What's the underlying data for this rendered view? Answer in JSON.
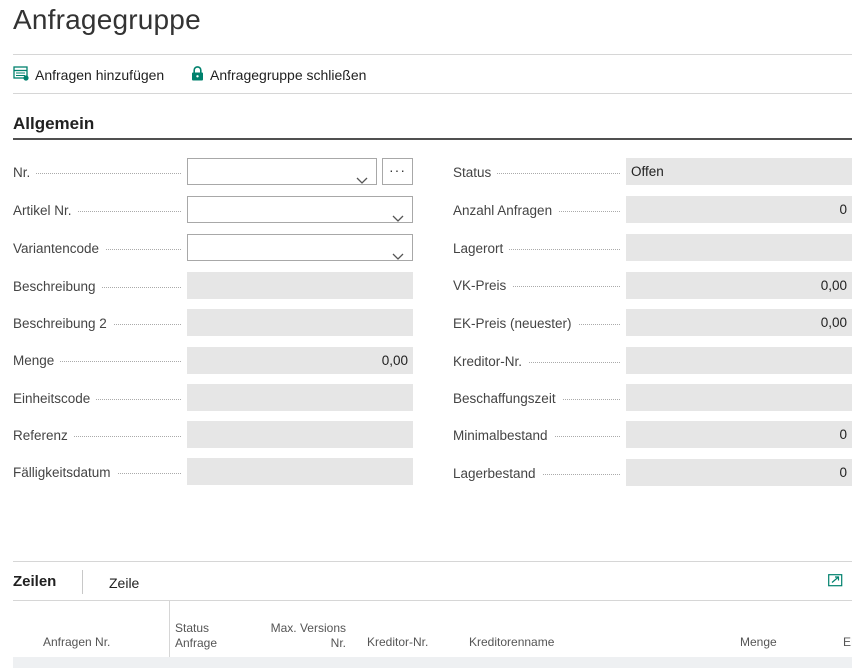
{
  "page": {
    "title": "Anfragegruppe"
  },
  "actions": {
    "add_requests": "Anfragen hinzufügen",
    "close_group": "Anfragegruppe schließen"
  },
  "general": {
    "section_title": "Allgemein",
    "nr": {
      "label": "Nr.",
      "value": ""
    },
    "artikel_nr": {
      "label": "Artikel Nr.",
      "value": ""
    },
    "variantencode": {
      "label": "Variantencode",
      "value": ""
    },
    "beschreibung": {
      "label": "Beschreibung",
      "value": ""
    },
    "beschreibung2": {
      "label": "Beschreibung 2",
      "value": ""
    },
    "menge": {
      "label": "Menge",
      "value": "0,00"
    },
    "einheitscode": {
      "label": "Einheitscode",
      "value": ""
    },
    "referenz": {
      "label": "Referenz",
      "value": ""
    },
    "faelligkeitsdatum": {
      "label": "Fälligkeitsdatum",
      "value": ""
    },
    "status": {
      "label": "Status",
      "value": "Offen"
    },
    "anzahl_anfragen": {
      "label": "Anzahl Anfragen",
      "value": "0"
    },
    "lagerort": {
      "label": "Lagerort",
      "value": ""
    },
    "vk_preis": {
      "label": "VK-Preis",
      "value": "0,00"
    },
    "ek_preis": {
      "label": "EK-Preis (neuester)",
      "value": "0,00"
    },
    "kreditor_nr": {
      "label": "Kreditor-Nr.",
      "value": ""
    },
    "beschaffungszeit": {
      "label": "Beschaffungszeit",
      "value": ""
    },
    "minimalbestand": {
      "label": "Minimalbestand",
      "value": "0"
    },
    "lagerbestand": {
      "label": "Lagerbestand",
      "value": "0"
    },
    "more_button": "···"
  },
  "lines": {
    "title": "Zeilen",
    "tab": "Zeile",
    "columns": {
      "anfragen_nr": "Anfragen Nr.",
      "status_anfrage_1": "Status",
      "status_anfrage_2": "Anfrage",
      "max_versions_1": "Max. Versions",
      "max_versions_2": "Nr.",
      "kreditor_nr": "Kreditor-Nr.",
      "kreditorenname": "Kreditorenname",
      "menge": "Menge",
      "ek": "EK"
    }
  },
  "icons": {
    "add_requests": "add-list-icon",
    "close_group": "lock-icon",
    "expand": "expand-icon"
  },
  "colors": {
    "accent": "#00816d",
    "readonly_field": "#e6e6e6"
  }
}
